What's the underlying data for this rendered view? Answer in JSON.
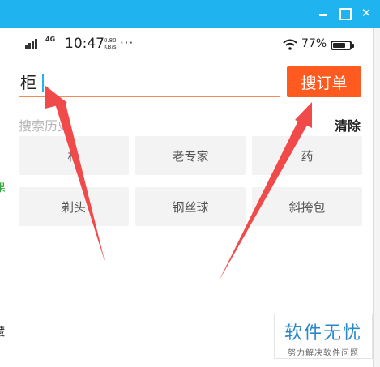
{
  "status_bar": {
    "network": "4G",
    "time": "10:47",
    "speed_value": "0.80",
    "speed_unit": "KB/s",
    "overflow": "···",
    "battery": "77%",
    "battery_level": 0.77
  },
  "search": {
    "value": "柜",
    "button_label": "搜订单"
  },
  "history": {
    "title": "搜索历史",
    "clear_label": "清除",
    "items": [
      "柜",
      "老专家",
      "药",
      "剃头",
      "钢丝球",
      "斜挎包"
    ]
  },
  "edge_fragments": [
    "果",
    "藏"
  ],
  "watermark": {
    "main": "软件无忧",
    "sub": "努力解决软件问题"
  },
  "colors": {
    "titlebar": "#1fb3ef",
    "accent": "#ff5a1f",
    "arrow": "#f04a4a"
  }
}
